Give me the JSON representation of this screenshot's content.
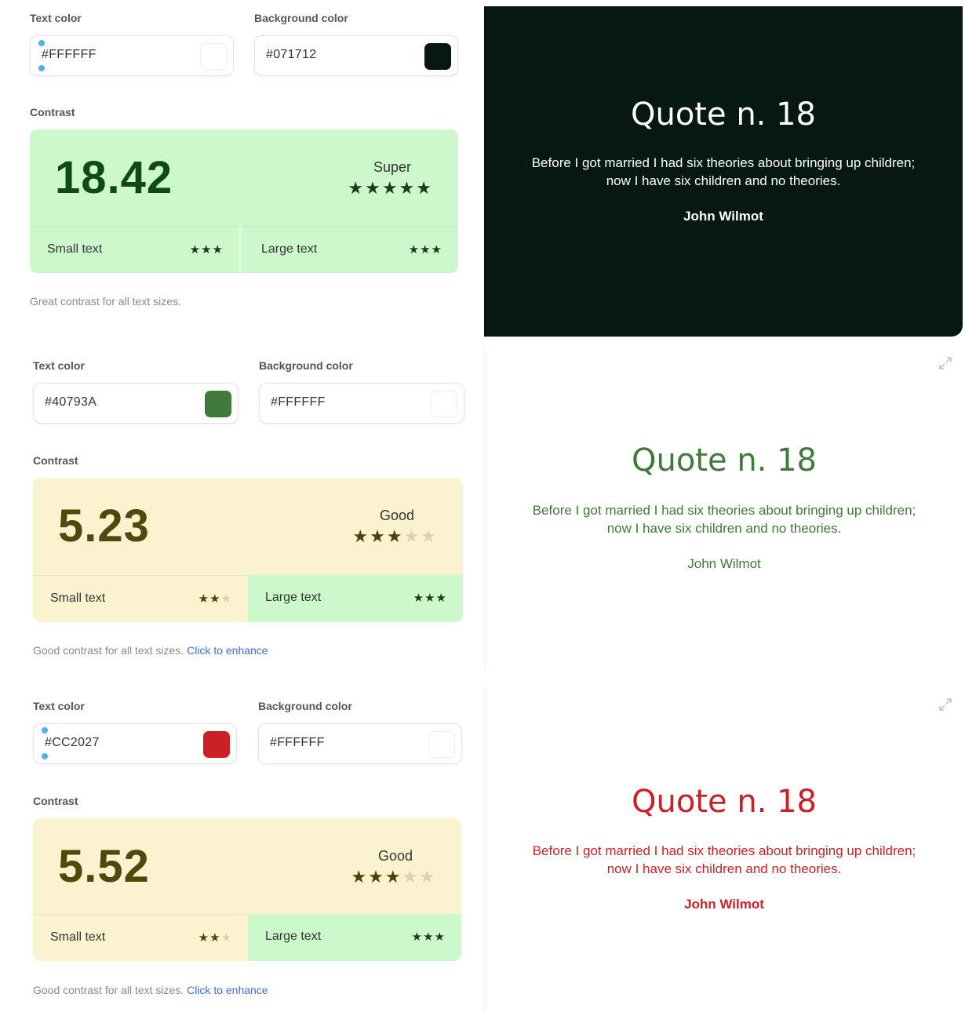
{
  "panels": [
    {
      "text_color_label": "Text color",
      "bg_color_label": "Background color",
      "text_color": "#FFFFFF",
      "bg_color": "#071712",
      "contrast_label": "Contrast",
      "score": "18.42",
      "rating": "Super",
      "stars": "★★★★★",
      "stars_dim": "",
      "small_text_label": "Small text",
      "small_stars": "★★★",
      "small_stars_dim": "",
      "large_text_label": "Large text",
      "large_stars": "★★★",
      "note": "Great contrast for all text sizes.",
      "note_link": "",
      "quote_title": "Quote n. 18",
      "quote_body": "Before I got married I had six theories about bringing up children; now I have six children and no theories.",
      "quote_author": "John Wilmot",
      "colors": {
        "card": "#cdf8cc",
        "card_small": "#cdf8cc",
        "card_large": "#cdf8cc",
        "score": "#0f4a14",
        "preview_bg": "#071712",
        "preview_fg": "#ffffff"
      }
    },
    {
      "text_color_label": "Text color",
      "bg_color_label": "Background color",
      "text_color": "#40793A",
      "bg_color": "#FFFFFF",
      "contrast_label": "Contrast",
      "score": "5.23",
      "rating": "Good",
      "stars": "★★★",
      "stars_dim": "★★",
      "small_text_label": "Small text",
      "small_stars": "★★",
      "small_stars_dim": "★",
      "large_text_label": "Large text",
      "large_stars": "★★★",
      "note": "Good contrast for all text sizes.",
      "note_link": "Click to enhance",
      "quote_title": "Quote n. 18",
      "quote_body": "Before I got married I had six theories about bringing up children; now I have six children and no theories.",
      "quote_author": "John Wilmot",
      "colors": {
        "card": "#fbf3cf",
        "card_small": "#fbf3cf",
        "card_large": "#cdf8cc",
        "score": "#4f4a0c",
        "preview_bg": "#ffffff",
        "preview_fg": "#40793A"
      }
    },
    {
      "text_color_label": "Text color",
      "bg_color_label": "Background color",
      "text_color": "#CC2027",
      "bg_color": "#FFFFFF",
      "contrast_label": "Contrast",
      "score": "5.52",
      "rating": "Good",
      "stars": "★★★",
      "stars_dim": "★★",
      "small_text_label": "Small text",
      "small_stars": "★★",
      "small_stars_dim": "★",
      "large_text_label": "Large text",
      "large_stars": "★★★",
      "note": "Good contrast for all text sizes.",
      "note_link": "Click to enhance",
      "quote_title": "Quote n. 18",
      "quote_body": "Before I got married I had six theories about bringing up children; now I have six children and no theories.",
      "quote_author": "John Wilmot",
      "colors": {
        "card": "#fbf3cf",
        "card_small": "#fbf3cf",
        "card_large": "#cdf8cc",
        "score": "#4f4a0c",
        "preview_bg": "#ffffff",
        "preview_fg": "#CC2027"
      }
    }
  ]
}
